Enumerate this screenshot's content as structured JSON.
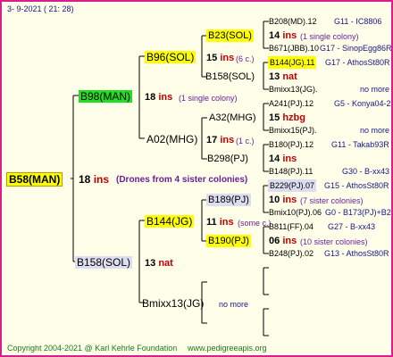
{
  "header": {
    "date": "3-  9-2021  ( 21:  28)"
  },
  "footer": {
    "copyright": "Copyright 2004-2021 @ Karl Kehrle Foundation",
    "site": "www.pedigreeapis.org"
  },
  "colors": {
    "border": "#d81f8c",
    "background": "#fffee9",
    "yellow": "#ffff00",
    "green": "#22dd22",
    "lilac": "#ddddf0"
  },
  "gen0": {
    "name": "B58(MAN)",
    "num": "18",
    "ins": "ins",
    "note": "(Drones from 4 sister colonies)"
  },
  "gen1": {
    "a": {
      "name": "B98(MAN)",
      "num": "18",
      "ins": "ins",
      "note": "(1 single colony)"
    },
    "b": {
      "name": "B158(SOL)",
      "num": "13",
      "tag": "nat"
    }
  },
  "gen2": {
    "aa": {
      "name": "B96(SOL)",
      "num": "15",
      "ins": "ins",
      "note": "(6 c.)"
    },
    "ab": {
      "name": "A02(MHG)",
      "num": "17",
      "ins": "ins",
      "note": "(1 c.)"
    },
    "ba": {
      "name": "B144(JG)",
      "num": "11",
      "ins": "ins",
      "note": "(some c.)"
    },
    "bb": {
      "name": "Bmixx13(JG)",
      "tag": "no more"
    }
  },
  "gen3": {
    "aaa": {
      "name": "B23(SOL)",
      "num": "14",
      "ins": "ins",
      "note": "(1 single colony)"
    },
    "aab": {
      "name": "B158(SOL)",
      "num": "13",
      "tag": "nat"
    },
    "aba": {
      "name": "A32(MHG)",
      "num": "15",
      "tag": "hzbg"
    },
    "abb": {
      "name": "B298(PJ)",
      "num": "14",
      "ins": "ins"
    },
    "baa": {
      "name": "B189(PJ)",
      "num": "10",
      "ins": "ins",
      "note": "(7 sister colonies)"
    },
    "bab": {
      "name": "B190(PJ)",
      "num": "06",
      "ins": "ins",
      "note": "(10 sister colonies)"
    }
  },
  "gen4": [
    {
      "name": "B208(MD).12",
      "group": "G11 - IC8806"
    },
    {
      "name": "B671(JBB).10",
      "group": "G17 - SinopEgg86R"
    },
    {
      "name": "B144(JG).11",
      "group": "G17 - AthosSt80R"
    },
    {
      "name": "Bmixx13(JG).",
      "group": "no more"
    },
    {
      "name": "A241(PJ).12",
      "group": "G5 - Konya04-2"
    },
    {
      "name": "Bmixx15(PJ).",
      "group": "no more"
    },
    {
      "name": "B180(PJ).12",
      "group": "G11 - Takab93R"
    },
    {
      "name": "B148(PJ).11",
      "group": "G30 - B-xx43"
    },
    {
      "name": "B229(PJ).07",
      "group": "G15 - AthosSt80R"
    },
    {
      "name": "Bmix10(PJ).06",
      "group": "G0 - B173(PJ)+B2"
    },
    {
      "name": "B811(FF).04",
      "group": "G27 - B-xx43"
    },
    {
      "name": "B248(PJ).02",
      "group": "G13 - AthosSt80R"
    }
  ]
}
